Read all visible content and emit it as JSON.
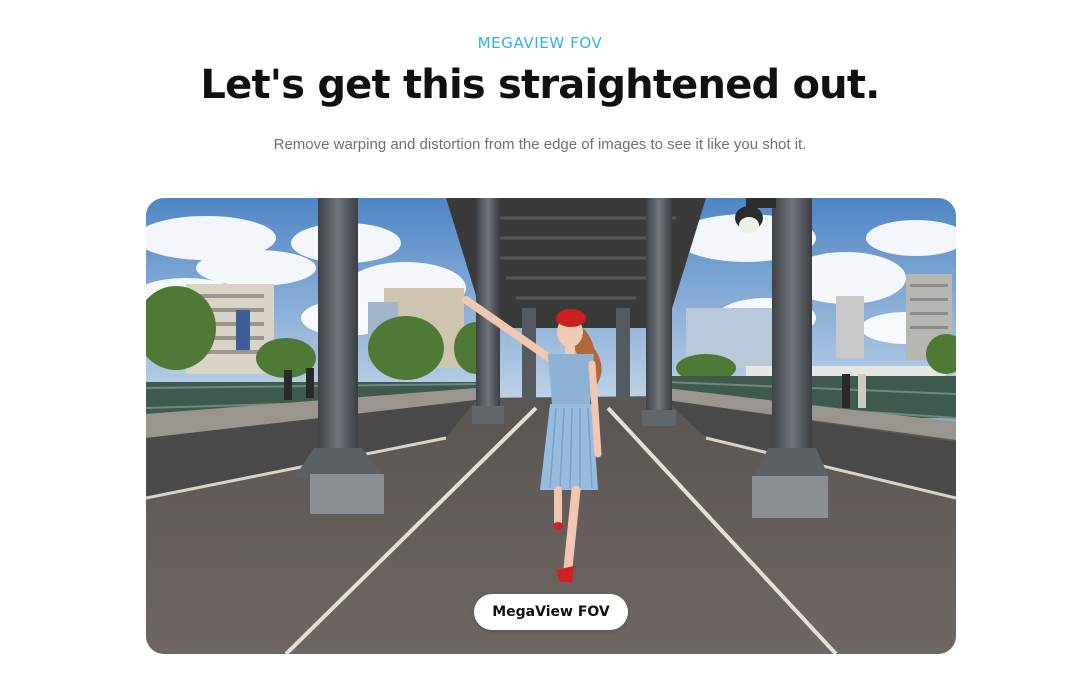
{
  "header": {
    "eyebrow": "MEGAVIEW FOV",
    "headline": "Let's get this straightened out.",
    "subtext": "Remove warping and distortion from the edge of images to see it like you shot it."
  },
  "media": {
    "badge_label": "MegaView FOV",
    "scene": "woman in blue dress and red beret walking under steel bridge with pillars, city buildings and cloudy sky"
  },
  "colors": {
    "accent": "#2fb2e6",
    "headline": "#111111",
    "subtext": "#707070"
  }
}
